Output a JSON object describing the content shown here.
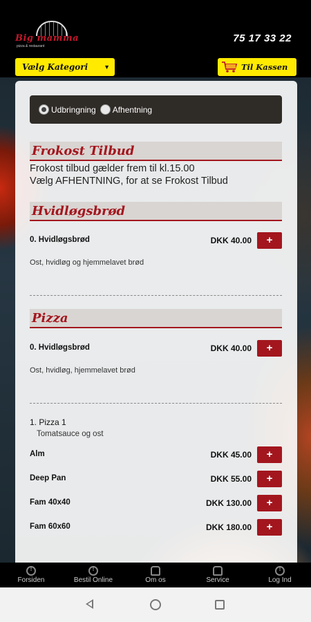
{
  "header": {
    "logo_brand": "Big mamma",
    "logo_tagline": "pizza & restaurant",
    "phone": "75 17 33 22",
    "category_select": "Vælg Kategori",
    "cart_button": "Til Kassen"
  },
  "delivery": {
    "options": [
      {
        "label": "Udbringning",
        "selected": true
      },
      {
        "label": "Afhentning",
        "selected": false
      }
    ]
  },
  "sections": {
    "frokost": {
      "title": "Frokost Tilbud",
      "lines": [
        "Frokost tilbud gælder frem til kl.15.00",
        "Vælg AFHENTNING, for at se Frokost Tilbud"
      ]
    },
    "hvidlog": {
      "title": "Hvidløgsbrød",
      "item_name": "0. Hvidløgsbrød",
      "item_price": "DKK 40.00",
      "item_desc": "Ost, hvidløg og hjemmelavet brød"
    },
    "pizza": {
      "title": "Pizza",
      "item_name": "0. Hvidløgsbrød",
      "item_price": "DKK 40.00",
      "item_desc": "Ost, hvidløg, hjemmelavet brød",
      "pizza1_name": "1. Pizza 1",
      "pizza1_desc": "Tomatsauce og ost",
      "sizes": [
        {
          "name": "Alm",
          "price": "DKK 45.00"
        },
        {
          "name": "Deep Pan",
          "price": "DKK 55.00"
        },
        {
          "name": "Fam 40x40",
          "price": "DKK 130.00"
        },
        {
          "name": "Fam 60x60",
          "price": "DKK 180.00"
        }
      ]
    }
  },
  "add_button_label": "+",
  "nav": [
    {
      "label": "Forsiden",
      "icon": "info-icon"
    },
    {
      "label": "Bestil Online",
      "icon": "info-icon"
    },
    {
      "label": "Om os",
      "icon": "person-icon"
    },
    {
      "label": "Service",
      "icon": "person-icon"
    },
    {
      "label": "Log Ind",
      "icon": "info-icon"
    }
  ],
  "colors": {
    "accent_red": "#a3161e",
    "button_yellow": "#ffea00",
    "header_black": "#000000"
  }
}
